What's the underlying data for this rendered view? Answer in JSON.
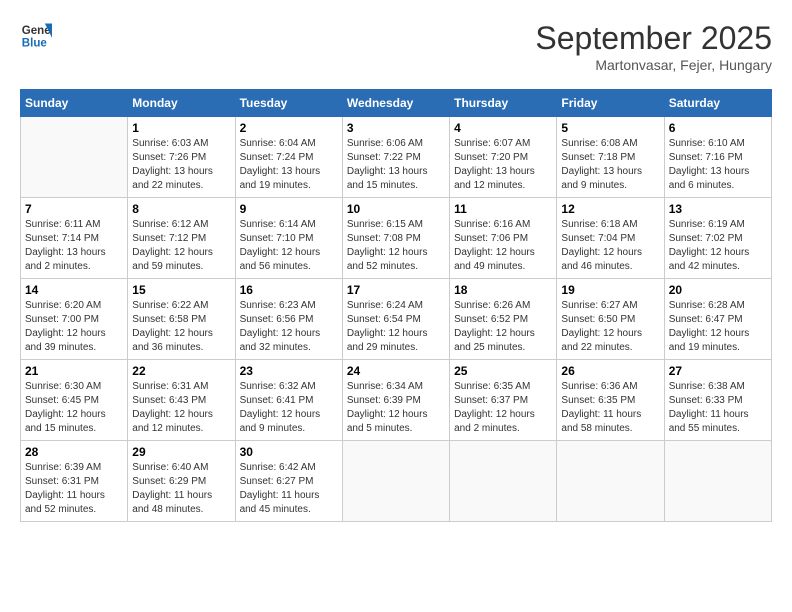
{
  "header": {
    "logo_line1": "General",
    "logo_line2": "Blue",
    "month": "September 2025",
    "location": "Martonvasar, Fejer, Hungary"
  },
  "weekdays": [
    "Sunday",
    "Monday",
    "Tuesday",
    "Wednesday",
    "Thursday",
    "Friday",
    "Saturday"
  ],
  "weeks": [
    [
      {
        "day": "",
        "info": ""
      },
      {
        "day": "1",
        "info": "Sunrise: 6:03 AM\nSunset: 7:26 PM\nDaylight: 13 hours\nand 22 minutes."
      },
      {
        "day": "2",
        "info": "Sunrise: 6:04 AM\nSunset: 7:24 PM\nDaylight: 13 hours\nand 19 minutes."
      },
      {
        "day": "3",
        "info": "Sunrise: 6:06 AM\nSunset: 7:22 PM\nDaylight: 13 hours\nand 15 minutes."
      },
      {
        "day": "4",
        "info": "Sunrise: 6:07 AM\nSunset: 7:20 PM\nDaylight: 13 hours\nand 12 minutes."
      },
      {
        "day": "5",
        "info": "Sunrise: 6:08 AM\nSunset: 7:18 PM\nDaylight: 13 hours\nand 9 minutes."
      },
      {
        "day": "6",
        "info": "Sunrise: 6:10 AM\nSunset: 7:16 PM\nDaylight: 13 hours\nand 6 minutes."
      }
    ],
    [
      {
        "day": "7",
        "info": "Sunrise: 6:11 AM\nSunset: 7:14 PM\nDaylight: 13 hours\nand 2 minutes."
      },
      {
        "day": "8",
        "info": "Sunrise: 6:12 AM\nSunset: 7:12 PM\nDaylight: 12 hours\nand 59 minutes."
      },
      {
        "day": "9",
        "info": "Sunrise: 6:14 AM\nSunset: 7:10 PM\nDaylight: 12 hours\nand 56 minutes."
      },
      {
        "day": "10",
        "info": "Sunrise: 6:15 AM\nSunset: 7:08 PM\nDaylight: 12 hours\nand 52 minutes."
      },
      {
        "day": "11",
        "info": "Sunrise: 6:16 AM\nSunset: 7:06 PM\nDaylight: 12 hours\nand 49 minutes."
      },
      {
        "day": "12",
        "info": "Sunrise: 6:18 AM\nSunset: 7:04 PM\nDaylight: 12 hours\nand 46 minutes."
      },
      {
        "day": "13",
        "info": "Sunrise: 6:19 AM\nSunset: 7:02 PM\nDaylight: 12 hours\nand 42 minutes."
      }
    ],
    [
      {
        "day": "14",
        "info": "Sunrise: 6:20 AM\nSunset: 7:00 PM\nDaylight: 12 hours\nand 39 minutes."
      },
      {
        "day": "15",
        "info": "Sunrise: 6:22 AM\nSunset: 6:58 PM\nDaylight: 12 hours\nand 36 minutes."
      },
      {
        "day": "16",
        "info": "Sunrise: 6:23 AM\nSunset: 6:56 PM\nDaylight: 12 hours\nand 32 minutes."
      },
      {
        "day": "17",
        "info": "Sunrise: 6:24 AM\nSunset: 6:54 PM\nDaylight: 12 hours\nand 29 minutes."
      },
      {
        "day": "18",
        "info": "Sunrise: 6:26 AM\nSunset: 6:52 PM\nDaylight: 12 hours\nand 25 minutes."
      },
      {
        "day": "19",
        "info": "Sunrise: 6:27 AM\nSunset: 6:50 PM\nDaylight: 12 hours\nand 22 minutes."
      },
      {
        "day": "20",
        "info": "Sunrise: 6:28 AM\nSunset: 6:47 PM\nDaylight: 12 hours\nand 19 minutes."
      }
    ],
    [
      {
        "day": "21",
        "info": "Sunrise: 6:30 AM\nSunset: 6:45 PM\nDaylight: 12 hours\nand 15 minutes."
      },
      {
        "day": "22",
        "info": "Sunrise: 6:31 AM\nSunset: 6:43 PM\nDaylight: 12 hours\nand 12 minutes."
      },
      {
        "day": "23",
        "info": "Sunrise: 6:32 AM\nSunset: 6:41 PM\nDaylight: 12 hours\nand 9 minutes."
      },
      {
        "day": "24",
        "info": "Sunrise: 6:34 AM\nSunset: 6:39 PM\nDaylight: 12 hours\nand 5 minutes."
      },
      {
        "day": "25",
        "info": "Sunrise: 6:35 AM\nSunset: 6:37 PM\nDaylight: 12 hours\nand 2 minutes."
      },
      {
        "day": "26",
        "info": "Sunrise: 6:36 AM\nSunset: 6:35 PM\nDaylight: 11 hours\nand 58 minutes."
      },
      {
        "day": "27",
        "info": "Sunrise: 6:38 AM\nSunset: 6:33 PM\nDaylight: 11 hours\nand 55 minutes."
      }
    ],
    [
      {
        "day": "28",
        "info": "Sunrise: 6:39 AM\nSunset: 6:31 PM\nDaylight: 11 hours\nand 52 minutes."
      },
      {
        "day": "29",
        "info": "Sunrise: 6:40 AM\nSunset: 6:29 PM\nDaylight: 11 hours\nand 48 minutes."
      },
      {
        "day": "30",
        "info": "Sunrise: 6:42 AM\nSunset: 6:27 PM\nDaylight: 11 hours\nand 45 minutes."
      },
      {
        "day": "",
        "info": ""
      },
      {
        "day": "",
        "info": ""
      },
      {
        "day": "",
        "info": ""
      },
      {
        "day": "",
        "info": ""
      }
    ]
  ]
}
